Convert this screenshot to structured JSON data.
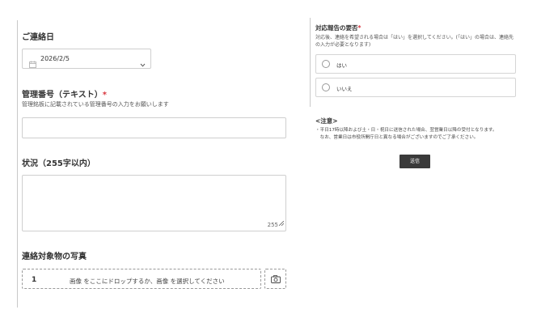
{
  "contact_date": {
    "title": "ご連絡日",
    "value": "2026/2/5"
  },
  "management_number": {
    "title": "管理番号（テキスト）",
    "required_mark": "*",
    "description": "管理銘板に記載されている管理番号の入力をお願いします",
    "value": ""
  },
  "status": {
    "title": "状況（255字以内）",
    "counter": "255",
    "value": ""
  },
  "photo": {
    "title": "連絡対象物の写真",
    "index": "1",
    "drop_text": "画像 をここにドロップするか、画像 を選択してください"
  },
  "response_report": {
    "title": "対応報告の要否",
    "required_mark": "*",
    "description": "対応後、連絡を希望される場合は「はい」を選択してください。(「はい」の場合は、連絡先の入力が必要となります)",
    "options": [
      {
        "label": "はい",
        "selected": false
      },
      {
        "label": "いいえ",
        "selected": false
      }
    ]
  },
  "notes": {
    "title": "<注意>",
    "lines": [
      "・平日17時以降および土・日・祝日に送信された場合、翌営業日以降の受付となります。",
      "　なお、営業日は市役所開庁日と異なる場合がございますのでご了承ください。"
    ]
  },
  "submit": {
    "label": "送信"
  }
}
